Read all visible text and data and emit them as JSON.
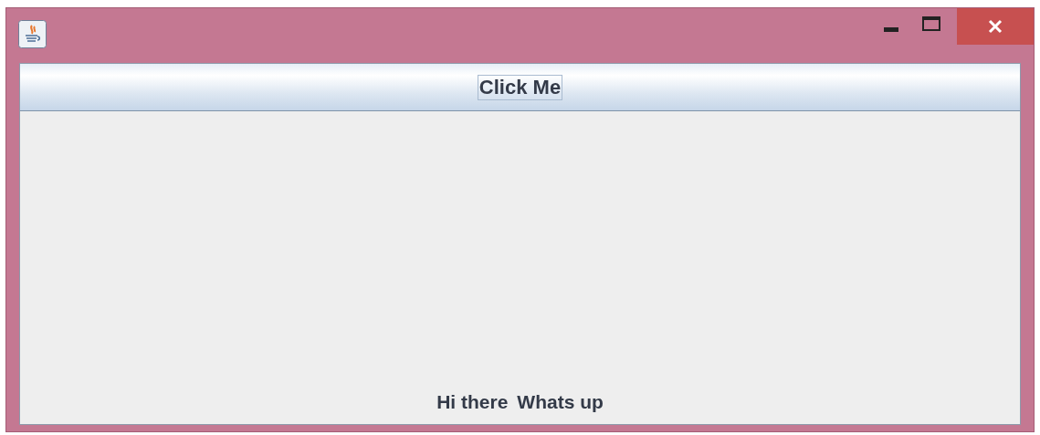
{
  "button": {
    "label": "Click Me",
    "focused": true
  },
  "labels": [
    "Hi there",
    "Whats up"
  ]
}
